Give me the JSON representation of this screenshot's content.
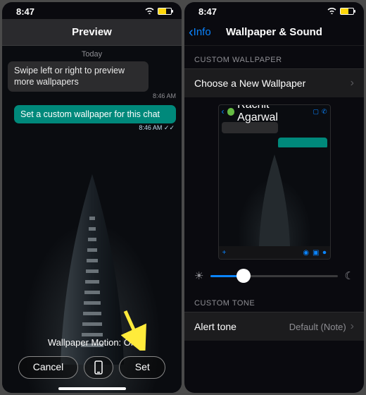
{
  "left": {
    "status": {
      "time": "8:47"
    },
    "nav": {
      "title": "Preview"
    },
    "today": "Today",
    "msg_in": "Swipe left or right to preview more wallpapers",
    "msg_in_time": "8:46 AM",
    "msg_out": "Set a custom wallpaper for this chat",
    "msg_out_time": "8:46 AM ✓✓",
    "motion": "Wallpaper Motion: On",
    "cancel": "Cancel",
    "set": "Set"
  },
  "right": {
    "status": {
      "time": "8:47"
    },
    "nav": {
      "back": "Info",
      "title": "Wallpaper & Sound"
    },
    "sect1": "CUSTOM WALLPAPER",
    "choose": "Choose a New Wallpaper",
    "preview": {
      "name": "Rachit Agarwal"
    },
    "slider_value": 0.26,
    "sect2": "CUSTOM TONE",
    "alert": "Alert tone",
    "alert_value": "Default (Note)"
  }
}
